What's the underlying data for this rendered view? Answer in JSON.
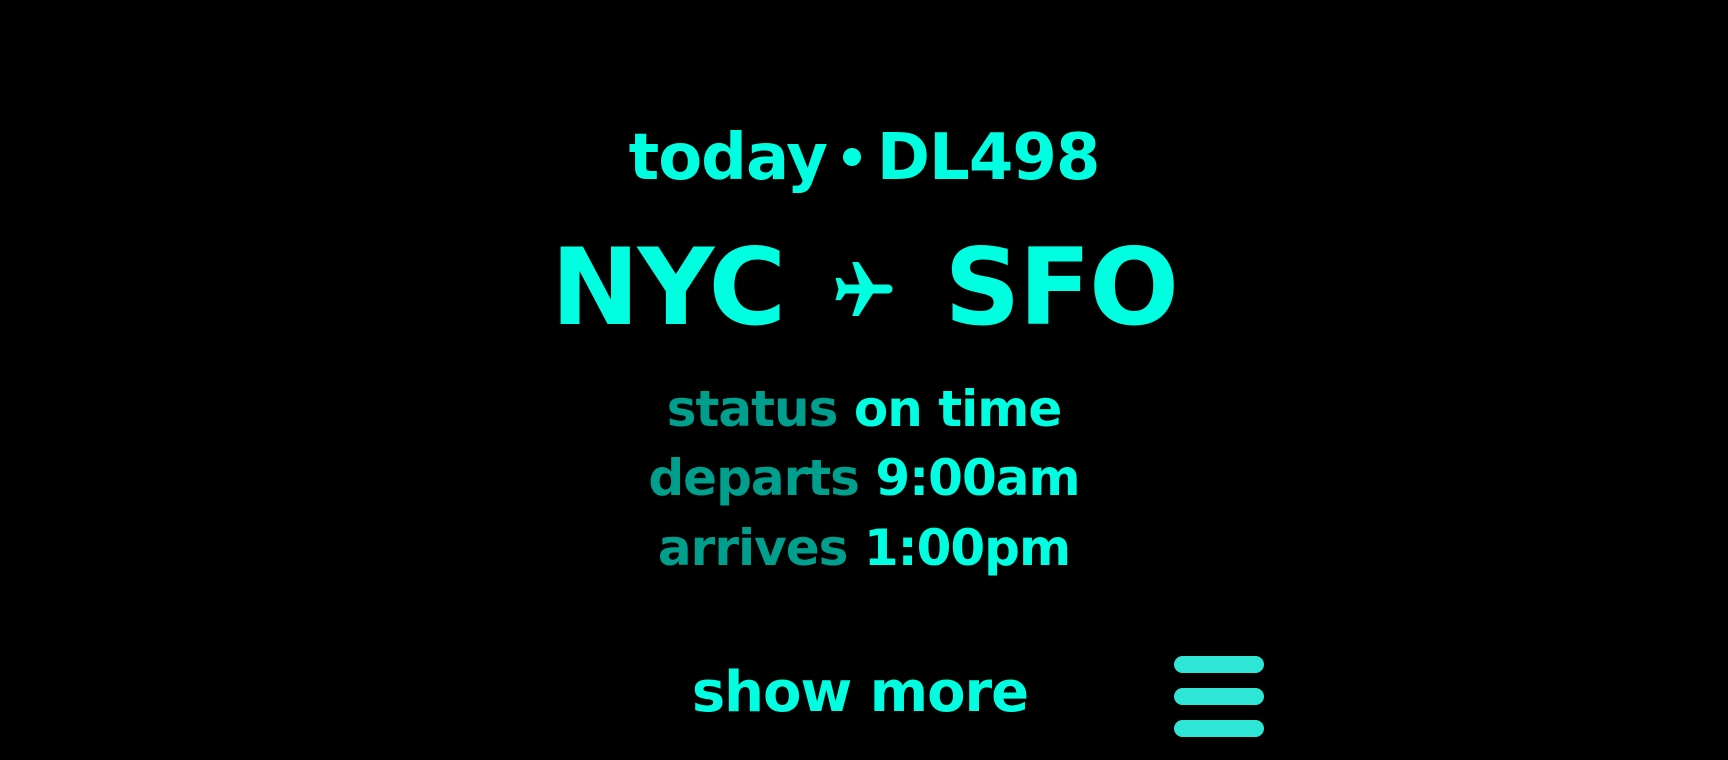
{
  "flight": {
    "day": "today",
    "number": "DL498",
    "origin": "NYC",
    "destination": "SFO"
  },
  "details": {
    "status_label": "status",
    "status_value": "on time",
    "departs_label": "departs",
    "departs_value": "9:00am",
    "arrives_label": "arrives",
    "arrives_value": "1:00pm"
  },
  "actions": {
    "show_more_label": "show more",
    "menu_icon": "hamburger-menu-icon"
  },
  "colors": {
    "background": "#000000",
    "accent": "#00ffe0",
    "muted_accent": "#009e8c",
    "menu_icon": "#2ee6d6"
  }
}
